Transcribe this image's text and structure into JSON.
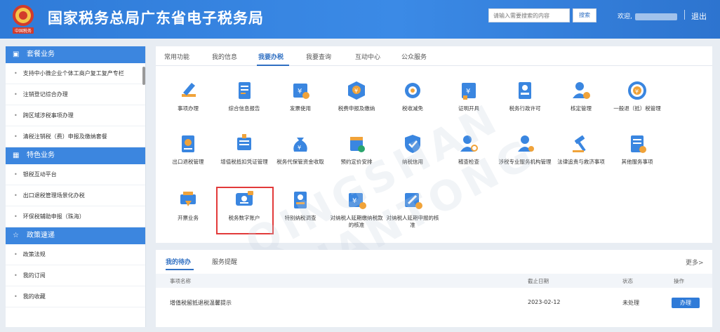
{
  "header": {
    "title": "国家税务总局广东省电子税务局",
    "emblem_caption": "中国税务",
    "search_placeholder": "请输入需要搜索的内容",
    "search_button": "搜索",
    "welcome_label": "欢迎,",
    "logout_label": "退出"
  },
  "sidebar": {
    "sections": [
      {
        "title": "套餐业务",
        "icon": "square-dot-icon",
        "items": [
          "支持中小微企业个体工商户复工复产专栏",
          "注销登记综合办理",
          "跨区域涉税事项办理",
          "清税注销税（费）申报及缴纳套餐"
        ]
      },
      {
        "title": "特色业务",
        "icon": "grid-icon",
        "items": [
          "银税互动平台",
          "出口退税管理场景化办税",
          "环保税辅助申报（珠海）"
        ]
      },
      {
        "title": "政策速递",
        "icon": "star-icon",
        "items": [
          "政策法规",
          "我的订阅",
          "我的收藏"
        ]
      }
    ]
  },
  "tabs": [
    "常用功能",
    "我的信息",
    "我要办税",
    "我要查询",
    "互动中心",
    "公众服务"
  ],
  "active_tab": "我要办税",
  "services": [
    {
      "label": "事项办理",
      "icon": "pen-icon"
    },
    {
      "label": "综合信息报告",
      "icon": "document-report-icon"
    },
    {
      "label": "发票使用",
      "icon": "invoice-star-icon"
    },
    {
      "label": "税费申报及缴纳",
      "icon": "tax-box-icon"
    },
    {
      "label": "税收减免",
      "icon": "reduction-icon"
    },
    {
      "label": "证明开具",
      "icon": "certificate-icon"
    },
    {
      "label": "税务行政许可",
      "icon": "license-icon"
    },
    {
      "label": "核定管理",
      "icon": "user-gear-icon"
    },
    {
      "label": "一般退（抵）税管理",
      "icon": "refund-icon"
    },
    {
      "label": "出口退税管理",
      "icon": "export-refund-icon"
    },
    {
      "label": "增值税抵扣凭证管理",
      "icon": "voucher-icon"
    },
    {
      "label": "税务代保管资金收取",
      "icon": "money-bag-icon"
    },
    {
      "label": "预约定价安排",
      "icon": "calendar-doc-icon"
    },
    {
      "label": "纳税信用",
      "icon": "credit-shield-icon"
    },
    {
      "label": "稽查检查",
      "icon": "inspector-icon"
    },
    {
      "label": "涉税专业服务机构管理",
      "icon": "agency-icon"
    },
    {
      "label": "法律追责与救济事项",
      "icon": "gavel-icon"
    },
    {
      "label": "其他服务事项",
      "icon": "list-gear-icon"
    },
    {
      "label": "开票业务",
      "icon": "invoice-print-icon"
    },
    {
      "label": "税务数字账户",
      "icon": "digital-account-icon"
    },
    {
      "label": "特别纳税调查",
      "icon": "investigation-icon"
    },
    {
      "label": "对纳税人延期缴纳税款的核准",
      "icon": "deferral-pay-icon"
    },
    {
      "label": "对纳税人延期申报的核准",
      "icon": "deferral-file-icon"
    }
  ],
  "todo": {
    "tabs": [
      "我的待办",
      "服务提醒"
    ],
    "more": "更多>",
    "columns": [
      "事项名称",
      "截止日期",
      "状态",
      "操作"
    ],
    "rows": [
      {
        "name": "增值税留抵退税温馨提示",
        "deadline": "2023-02-12",
        "status": "未处理",
        "action": "办理"
      }
    ]
  },
  "colors": {
    "header_blue": "#2f7bd8",
    "accent_blue": "#2f6fc2",
    "highlight_red": "#e23a3a",
    "icon_blue": "#3a86e0",
    "icon_orange": "#f0a33a"
  },
  "watermark": "QINGSHAN QUANTONG"
}
